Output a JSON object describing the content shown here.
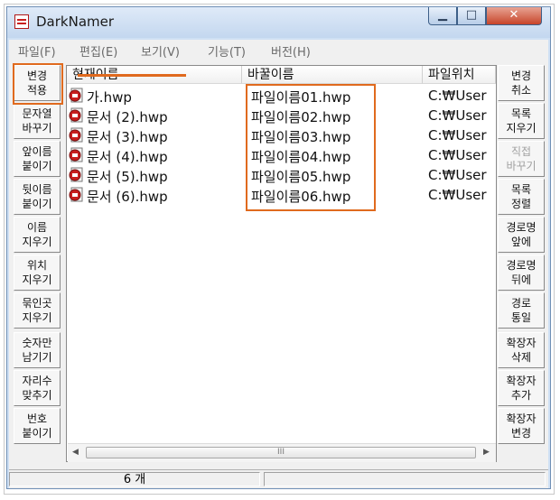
{
  "window": {
    "title": "DarkNamer"
  },
  "titlebar_buttons": {
    "minimize": "▁",
    "maximize": "□",
    "close": "✕"
  },
  "menu": [
    "파일(F)",
    "편집(E)",
    "보기(V)",
    "기능(T)",
    "버전(H)"
  ],
  "left_buttons": [
    {
      "label": "변경\n적용",
      "enabled": true
    },
    {
      "label": "문자열\n바꾸기",
      "enabled": true
    },
    {
      "label": "앞이름\n붙이기",
      "enabled": true
    },
    {
      "label": "뒷이름\n붙이기",
      "enabled": true
    },
    {
      "label": "이름\n지우기",
      "enabled": true
    },
    {
      "label": "위치\n지우기",
      "enabled": true
    },
    {
      "label": "묶인곳\n지우기",
      "enabled": true
    },
    {
      "label": "숫자만\n남기기",
      "enabled": true
    },
    {
      "label": "자리수\n맞추기",
      "enabled": true
    },
    {
      "label": "번호\n붙이기",
      "enabled": true
    }
  ],
  "right_buttons": [
    {
      "label": "변경\n취소",
      "enabled": true
    },
    {
      "label": "목록\n지우기",
      "enabled": true
    },
    {
      "label": "직접\n바꾸기",
      "enabled": false
    },
    {
      "label": "목록\n정렬",
      "enabled": true
    },
    {
      "label": "경로명\n앞에",
      "enabled": true
    },
    {
      "label": "경로명\n뒤에",
      "enabled": true
    },
    {
      "label": "경로\n통일",
      "enabled": true
    },
    {
      "label": "확장자\n삭제",
      "enabled": true
    },
    {
      "label": "확장자\n추가",
      "enabled": true
    },
    {
      "label": "확장자\n변경",
      "enabled": true
    }
  ],
  "list": {
    "columns": [
      "현재이름",
      "바꿀이름",
      "파일위치"
    ],
    "rows": [
      {
        "current": "가.hwp",
        "new": "파일이름01.hwp",
        "location": "C:₩User"
      },
      {
        "current": "문서 (2).hwp",
        "new": "파일이름02.hwp",
        "location": "C:₩User"
      },
      {
        "current": "문서 (3).hwp",
        "new": "파일이름03.hwp",
        "location": "C:₩User"
      },
      {
        "current": "문서 (4).hwp",
        "new": "파일이름04.hwp",
        "location": "C:₩User"
      },
      {
        "current": "문서 (5).hwp",
        "new": "파일이름05.hwp",
        "location": "C:₩User"
      },
      {
        "current": "문서 (6).hwp",
        "new": "파일이름06.hwp",
        "location": "C:₩User"
      }
    ],
    "file_icon": "hwp-file-icon"
  },
  "scrollbar": {
    "left_arrow": "◀",
    "right_arrow": "▶",
    "thumb_grip": "III"
  },
  "status": {
    "count": "6 개"
  },
  "colors": {
    "highlight": "#e06a1e",
    "file_icon_red": "#c81e1e"
  }
}
